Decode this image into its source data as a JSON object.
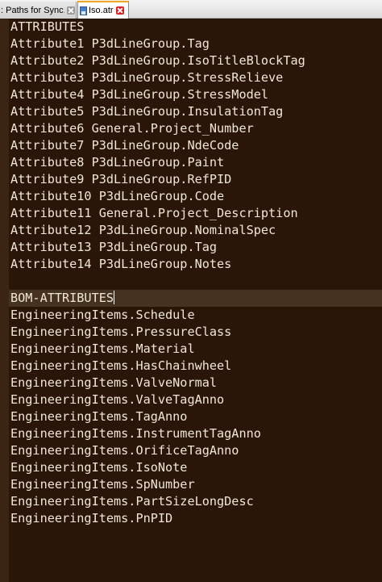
{
  "tabs": [
    {
      "label": ": Paths for Sync.txt",
      "active": false
    },
    {
      "label": "Iso.atr",
      "active": true
    }
  ],
  "editor": {
    "lines": [
      "ATTRIBUTES",
      "Attribute1 P3dLineGroup.Tag",
      "Attribute2 P3dLineGroup.IsoTitleBlockTag",
      "Attribute3 P3dLineGroup.StressRelieve",
      "Attribute4 P3dLineGroup.StressModel",
      "Attribute5 P3dLineGroup.InsulationTag",
      "Attribute6 General.Project_Number",
      "Attribute7 P3dLineGroup.NdeCode",
      "Attribute8 P3dLineGroup.Paint",
      "Attribute9 P3dLineGroup.RefPID",
      "Attribute10 P3dLineGroup.Code",
      "Attribute11 General.Project_Description",
      "Attribute12 P3dLineGroup.NominalSpec",
      "Attribute13 P3dLineGroup.Tag",
      "Attribute14 P3dLineGroup.Notes",
      "",
      "BOM-ATTRIBUTES",
      "EngineeringItems.Schedule",
      "EngineeringItems.PressureClass",
      "EngineeringItems.Material",
      "EngineeringItems.HasChainwheel",
      "EngineeringItems.ValveNormal",
      "EngineeringItems.ValveTagAnno",
      "EngineeringItems.TagAnno",
      "EngineeringItems.InstrumentTagAnno",
      "EngineeringItems.OrificeTagAnno",
      "EngineeringItems.IsoNote",
      "EngineeringItems.SpNumber",
      "EngineeringItems.PartSizeLongDesc",
      "EngineeringItems.PnPID"
    ],
    "current_line": 16
  },
  "colors": {
    "background": "#2a1606",
    "text": "#f1e7d6",
    "current_line_highlight": "#453221",
    "active_tab_accent": "#f5a623"
  }
}
